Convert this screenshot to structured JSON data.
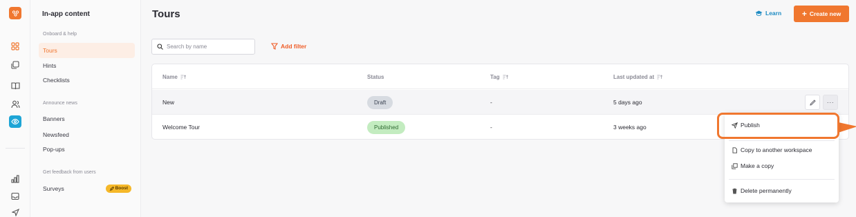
{
  "rail": {
    "icons": [
      "logo-icon",
      "dashboard-icon",
      "layers-icon",
      "book-icon",
      "users-icon",
      "eye-icon",
      "chart-icon",
      "inbox-icon",
      "send-icon"
    ]
  },
  "sidebar": {
    "title": "In-app content",
    "sections": [
      {
        "label": "Onboard & help"
      },
      {
        "label": "Announce news"
      },
      {
        "label": "Get feedback from users"
      }
    ],
    "items": [
      {
        "label": "Tours",
        "active": true
      },
      {
        "label": "Hints"
      },
      {
        "label": "Checklists"
      },
      {
        "label": "Banners"
      },
      {
        "label": "Newsfeed"
      },
      {
        "label": "Pop-ups"
      },
      {
        "label": "Surveys",
        "badge": "Boost"
      }
    ]
  },
  "header": {
    "title": "Tours",
    "learn_label": "Learn",
    "create_label": "Create new"
  },
  "toolbar": {
    "search_placeholder": "Search by name",
    "add_filter_label": "Add filter"
  },
  "table": {
    "columns": [
      "Name",
      "Status",
      "Tag",
      "Last updated at"
    ],
    "rows": [
      {
        "name": "New",
        "status": "Draft",
        "tag": "-",
        "updated": "5 days ago"
      },
      {
        "name": "Welcome Tour",
        "status": "Published",
        "tag": "-",
        "updated": "3 weeks ago"
      }
    ]
  },
  "menu": {
    "items": [
      {
        "label": "Publish",
        "icon": "send-icon"
      },
      {
        "label": "Copy to another workspace",
        "icon": "copy-file-icon"
      },
      {
        "label": "Make a copy",
        "icon": "duplicate-icon"
      },
      {
        "label": "Delete permanently",
        "icon": "trash-icon"
      }
    ]
  },
  "colors": {
    "accent": "#f0772f",
    "link": "#1e8bc3",
    "draft_pill": "#d7dbe1",
    "published_pill": "#c3ecc0"
  }
}
